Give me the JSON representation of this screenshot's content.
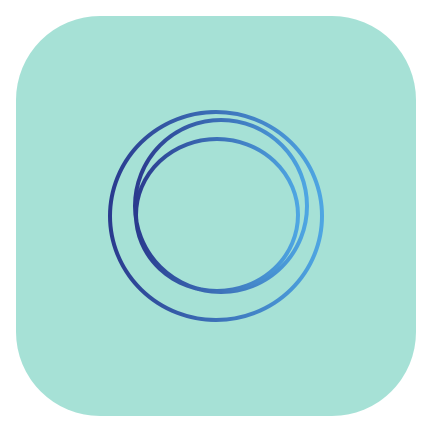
{
  "icon": {
    "name": "rings-logo-icon",
    "colors": {
      "tile_background": "#a6e1d6",
      "gradient_start": "#2a3a8e",
      "gradient_end": "#4ea6e2"
    }
  }
}
